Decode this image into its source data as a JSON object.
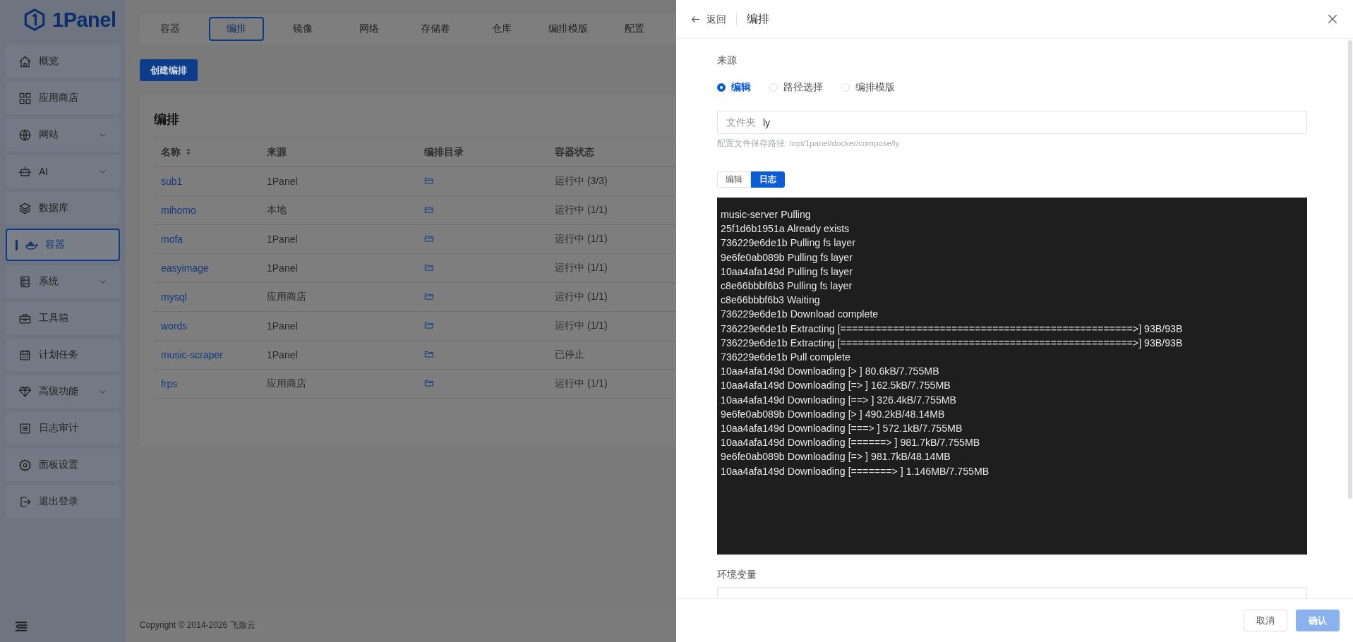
{
  "logo": {
    "text": "1Panel"
  },
  "sidebar": {
    "items": [
      {
        "label": "概览",
        "selected": false,
        "expandable": false
      },
      {
        "label": "应用商店",
        "selected": false,
        "expandable": false
      },
      {
        "label": "网站",
        "selected": false,
        "expandable": true
      },
      {
        "label": "AI",
        "selected": false,
        "expandable": true
      },
      {
        "label": "数据库",
        "selected": false,
        "expandable": false
      },
      {
        "label": "容器",
        "selected": true,
        "expandable": false
      },
      {
        "label": "系统",
        "selected": false,
        "expandable": true
      },
      {
        "label": "工具箱",
        "selected": false,
        "expandable": false
      },
      {
        "label": "计划任务",
        "selected": false,
        "expandable": false
      },
      {
        "label": "高级功能",
        "selected": false,
        "expandable": true
      },
      {
        "label": "日志审计",
        "selected": false,
        "expandable": false
      },
      {
        "label": "面板设置",
        "selected": false,
        "expandable": false
      },
      {
        "label": "退出登录",
        "selected": false,
        "expandable": false
      }
    ]
  },
  "tabs": [
    {
      "label": "容器",
      "selected": false
    },
    {
      "label": "编排",
      "selected": true
    },
    {
      "label": "镜像",
      "selected": false
    },
    {
      "label": "网络",
      "selected": false
    },
    {
      "label": "存储卷",
      "selected": false
    },
    {
      "label": "仓库",
      "selected": false
    },
    {
      "label": "编排模版",
      "selected": false
    },
    {
      "label": "配置",
      "selected": false
    }
  ],
  "create_button": "创建编排",
  "card": {
    "title": "编排",
    "table": {
      "columns": [
        {
          "label": "名称",
          "sortable": true
        },
        {
          "label": "来源",
          "sortable": false
        },
        {
          "label": "编排目录",
          "sortable": false
        },
        {
          "label": "容器状态",
          "sortable": false
        }
      ],
      "rows": [
        {
          "name": "sub1",
          "source": "1Panel",
          "status": "运行中 (3/3)"
        },
        {
          "name": "mihomo",
          "source": "本地",
          "status": "运行中 (1/1)"
        },
        {
          "name": "mofa",
          "source": "1Panel",
          "status": "运行中 (1/1)"
        },
        {
          "name": "easyimage",
          "source": "1Panel",
          "status": "运行中 (1/1)"
        },
        {
          "name": "mysql",
          "source": "应用商店",
          "status": "运行中 (1/1)"
        },
        {
          "name": "words",
          "source": "1Panel",
          "status": "运行中 (1/1)"
        },
        {
          "name": "music-scraper",
          "source": "1Panel",
          "status": "已停止"
        },
        {
          "name": "frps",
          "source": "应用商店",
          "status": "运行中 (1/1)"
        }
      ]
    }
  },
  "footer": {
    "copyright": "Copyright © 2014-2026 飞致云"
  },
  "drawer": {
    "back": "返回",
    "title": "编排",
    "source_label": "来源",
    "source_options": [
      {
        "label": "编辑",
        "selected": true
      },
      {
        "label": "路径选择",
        "selected": false
      },
      {
        "label": "编排模版",
        "selected": false
      }
    ],
    "folder_field": {
      "prefix": "文件夹",
      "value": "ly"
    },
    "path_hint": "配置文件保存路径: /opt/1panel/docker/compose/ly",
    "mode_tabs": [
      {
        "label": "编辑",
        "selected": false
      },
      {
        "label": "日志",
        "selected": true
      }
    ],
    "log_lines": [
      "music-server Pulling",
      "25f1d6b1951a Already exists",
      "736229e6de1b Pulling fs layer",
      "9e6fe0ab089b Pulling fs layer",
      "10aa4afa149d Pulling fs layer",
      "c8e66bbbf6b3 Pulling fs layer",
      "c8e66bbbf6b3 Waiting",
      "736229e6de1b Download complete",
      "736229e6de1b Extracting [==================================================>] 93B/93B",
      "736229e6de1b Extracting [==================================================>] 93B/93B",
      "736229e6de1b Pull complete",
      "10aa4afa149d Downloading [> ] 80.6kB/7.755MB",
      "10aa4afa149d Downloading [=> ] 162.5kB/7.755MB",
      "10aa4afa149d Downloading [==> ] 326.4kB/7.755MB",
      "9e6fe0ab089b Downloading [> ] 490.2kB/48.14MB",
      "10aa4afa149d Downloading [===> ] 572.1kB/7.755MB",
      "10aa4afa149d Downloading [======> ] 981.7kB/7.755MB",
      "9e6fe0ab089b Downloading [=> ] 981.7kB/48.14MB",
      "10aa4afa149d Downloading [=======> ] 1.146MB/7.755MB"
    ],
    "env_label": "环境变量",
    "buttons": [
      {
        "label": "取消",
        "kind": "default",
        "disabled": false
      },
      {
        "label": "确认",
        "kind": "primary",
        "disabled": true
      }
    ]
  }
}
